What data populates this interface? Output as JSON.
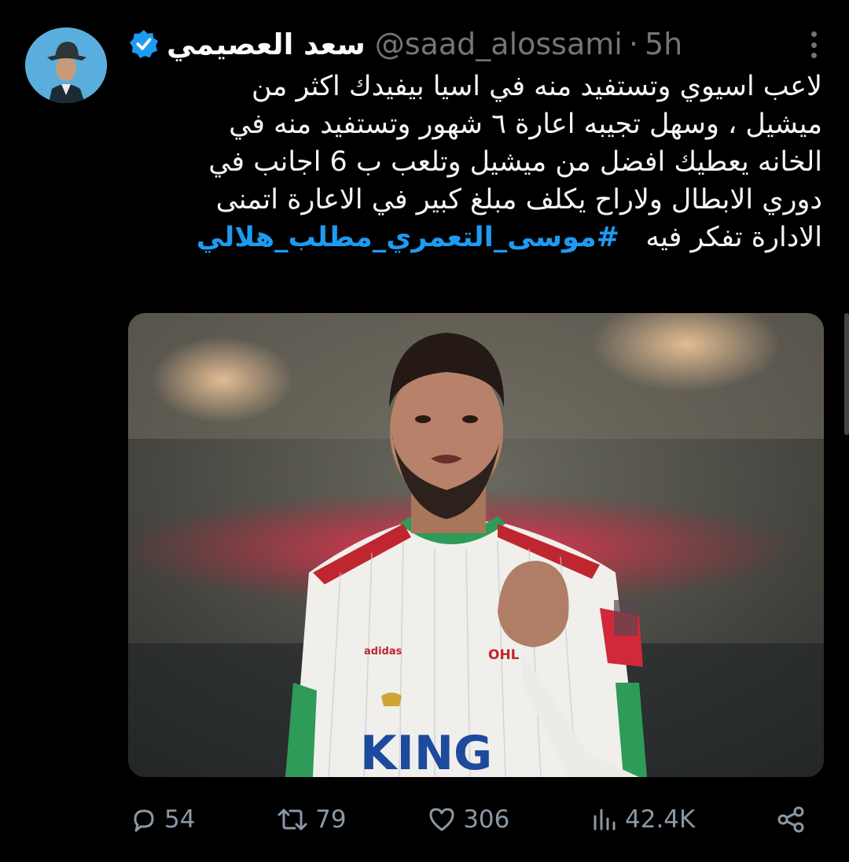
{
  "tweet": {
    "display_name": "سعد العصيمي",
    "handle": "@saad_alossami",
    "separator": "·",
    "time": "5h",
    "text_lines": [
      "لاعب اسيوي وتستفيد منه في اسيا بيفيدك اكثر من",
      "ميشيل ، وسهل تجيبه اعارة ٦ شهور وتستفيد منه في",
      "الخانه يعطيك افضل من ميشيل وتلعب ب 6 اجانب في",
      "دوري الابطال ولاراح يكلف مبلغ كبير في الاعارة اتمنى",
      "الادارة تفكر فيه"
    ],
    "hashtag": "#موسى_التعمري_مطلب_هلالي",
    "image_text": {
      "sponsor": "KING",
      "club": "OHL",
      "kit_brand": "adidas"
    }
  },
  "actions": {
    "replies": "54",
    "retweets": "79",
    "likes": "306",
    "views": "42.4K"
  },
  "colors": {
    "background": "#000000",
    "accent": "#1d9bf0",
    "muted": "#71767b"
  },
  "icons": [
    "verified-badge-icon",
    "more-options-icon",
    "reply-icon",
    "retweet-icon",
    "like-icon",
    "views-icon",
    "share-icon"
  ]
}
